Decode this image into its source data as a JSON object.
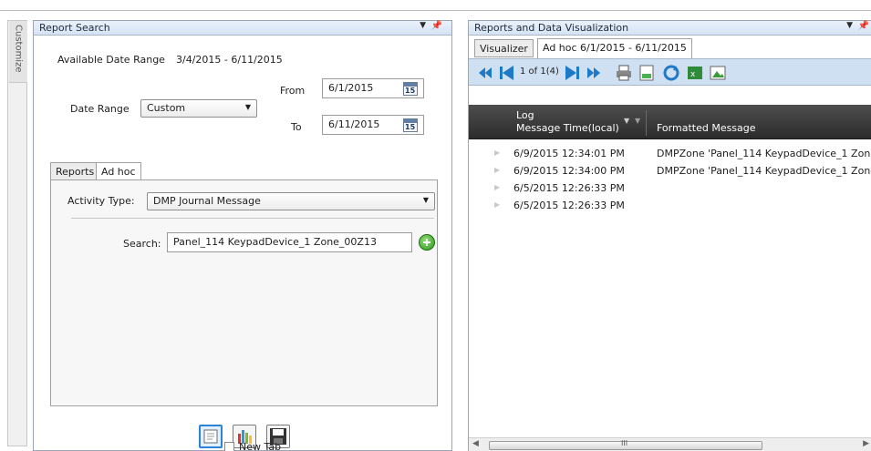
{
  "customize": {
    "label": "Customize"
  },
  "report_search": {
    "title": "Report Search",
    "available_range_label": "Available Date Range",
    "available_range_value": "3/4/2015 - 6/11/2015",
    "date_range_label": "Date Range",
    "date_range_value": "Custom",
    "from_label": "From",
    "from_value": "6/1/2015",
    "to_label": "To",
    "to_value": "6/11/2015",
    "calendar_day": "15",
    "tabs": [
      {
        "label": "Reports"
      },
      {
        "label": "Ad hoc"
      }
    ],
    "activity_type_label": "Activity Type:",
    "activity_type_value": "DMP Journal Message",
    "search_label": "Search:",
    "search_value": "Panel_114 KeypadDevice_1 Zone_00Z13",
    "new_tab_label": "New Tab"
  },
  "visualization": {
    "title": "Reports and Data Visualization",
    "tabs": [
      {
        "label": "Visualizer"
      },
      {
        "label": "Ad hoc 6/1/2015 - 6/11/2015"
      }
    ],
    "pager_text": "1 of 1(4)",
    "columns": [
      {
        "line1": "Log",
        "line2": "Message Time(local)"
      },
      {
        "label": "Formatted Message"
      }
    ],
    "rows": [
      {
        "time": "6/9/2015 12:34:01 PM",
        "message": "DMPZone 'Panel_114 KeypadDevice_1 Zone"
      },
      {
        "time": "6/9/2015 12:34:00 PM",
        "message": "DMPZone 'Panel_114 KeypadDevice_1 Zone"
      },
      {
        "time": "6/5/2015 12:26:33 PM",
        "message": ""
      },
      {
        "time": "6/5/2015 12:26:33 PM",
        "message": ""
      }
    ],
    "scroll_grip": "III"
  },
  "colors": {
    "accent": "#2b84d6",
    "grid_header": "#3a3a3a",
    "toolbar": "#cfe0f2",
    "add_green": "#2e9a1e"
  }
}
